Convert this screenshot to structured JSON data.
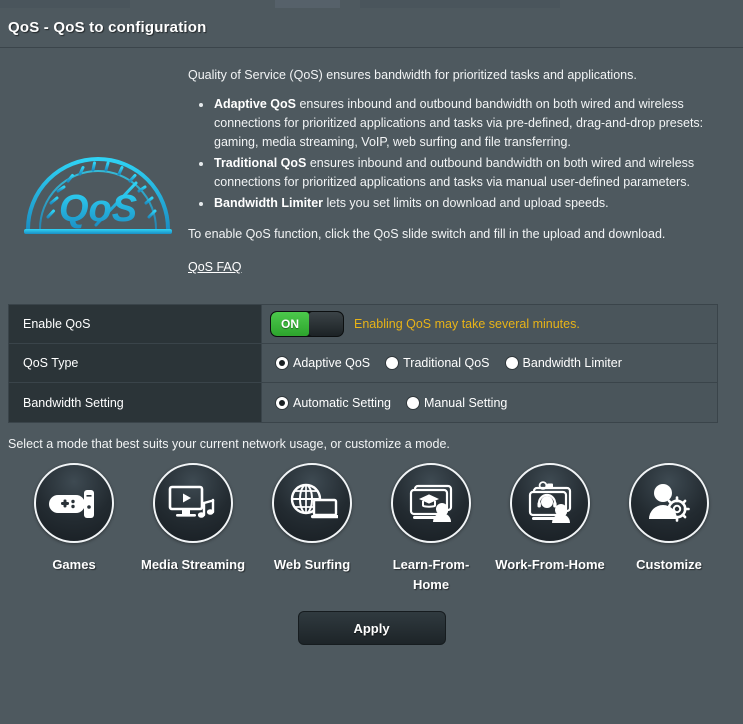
{
  "header": {
    "title": "QoS - QoS to configuration"
  },
  "intro": {
    "logo_text": "QoS",
    "lead": "Quality of Service (QoS) ensures bandwidth for prioritized tasks and applications.",
    "bullets": [
      {
        "term": "Adaptive QoS",
        "text": " ensures inbound and outbound bandwidth on both wired and wireless connections for prioritized applications and tasks via pre-defined, drag-and-drop presets: gaming, media streaming, VoIP, web surfing and file transferring."
      },
      {
        "term": "Traditional QoS",
        "text": " ensures inbound and outbound bandwidth on both wired and wireless connections for prioritized applications and tasks via manual user-defined parameters."
      },
      {
        "term": "Bandwidth Limiter",
        "text": " lets you set limits on download and upload speeds."
      }
    ],
    "enable_note": "To enable QoS function, click the QoS slide switch and fill in the upload and download.",
    "faq_link": "QoS FAQ"
  },
  "settings": {
    "enable_qos": {
      "label": "Enable QoS",
      "toggle_state": "ON",
      "warning": "Enabling QoS may take several minutes."
    },
    "qos_type": {
      "label": "QoS Type",
      "options": [
        {
          "label": "Adaptive QoS",
          "selected": true
        },
        {
          "label": "Traditional QoS",
          "selected": false
        },
        {
          "label": "Bandwidth Limiter",
          "selected": false
        }
      ]
    },
    "bandwidth_setting": {
      "label": "Bandwidth Setting",
      "options": [
        {
          "label": "Automatic Setting",
          "selected": true
        },
        {
          "label": "Manual Setting",
          "selected": false
        }
      ]
    }
  },
  "modes": {
    "hint": "Select a mode that best suits your current network usage, or customize a mode.",
    "items": [
      {
        "label": "Games",
        "icon": "gamepad-console-icon"
      },
      {
        "label": "Media Streaming",
        "icon": "monitor-play-music-icon"
      },
      {
        "label": "Web Surfing",
        "icon": "globe-laptop-icon"
      },
      {
        "label": "Learn-From-Home",
        "icon": "graduation-screen-person-icon"
      },
      {
        "label": "Work-From-Home",
        "icon": "video-conference-headset-icon"
      },
      {
        "label": "Customize",
        "icon": "person-gear-icon"
      }
    ]
  },
  "footer": {
    "apply_label": "Apply"
  },
  "colors": {
    "background": "#4e595f",
    "label_cell": "#2b3438",
    "value_cell": "#4a555b",
    "toggle_on": "#3cb83c",
    "warning_text": "#e8b317",
    "logo_accent": "#23b7e0"
  }
}
